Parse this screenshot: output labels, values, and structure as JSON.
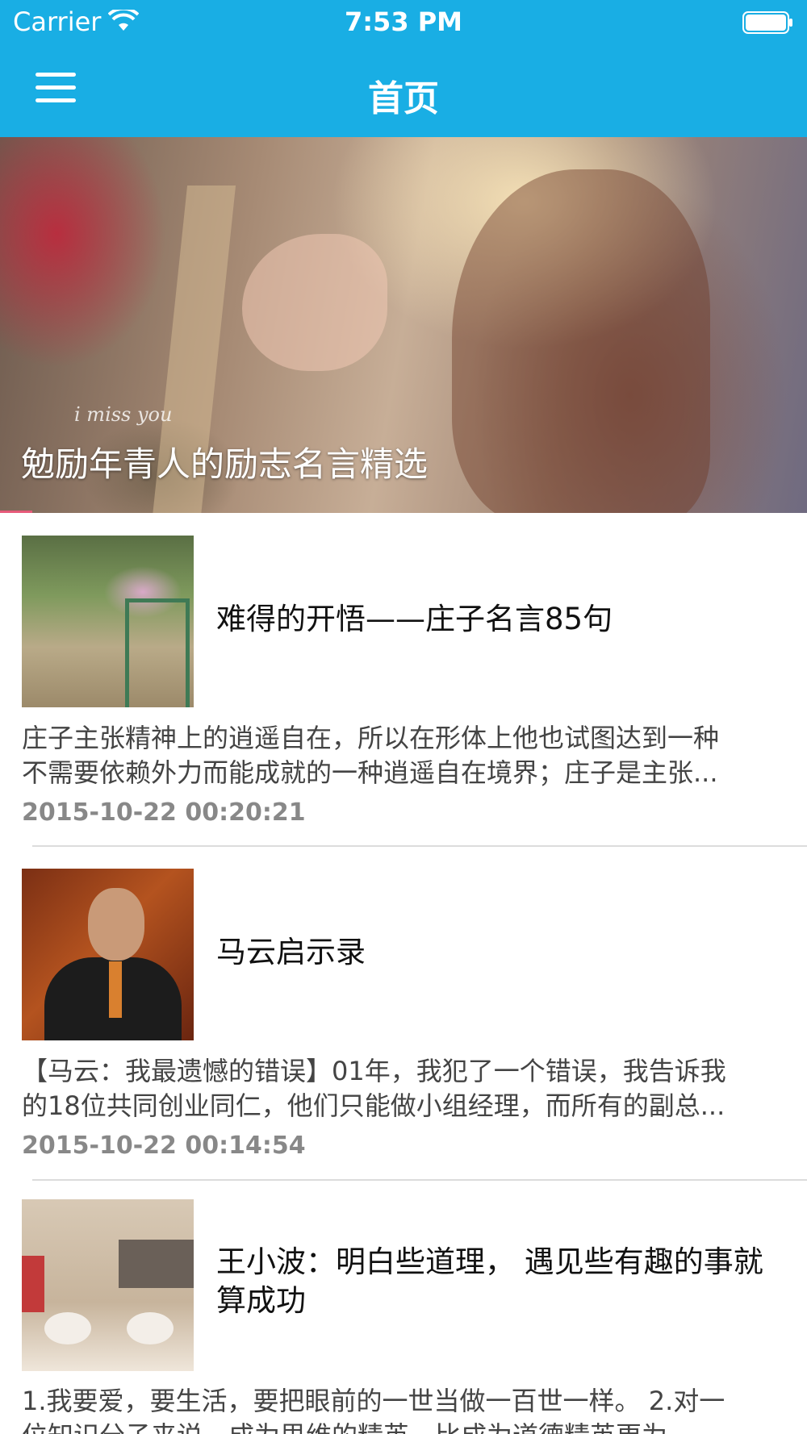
{
  "status_bar": {
    "carrier": "Carrier",
    "time": "7:53 PM",
    "wifi_icon": "wifi-icon",
    "battery_icon": "battery-icon"
  },
  "nav": {
    "title": "首页",
    "menu_icon": "hamburger-menu-icon",
    "bar_color": "#19aee4"
  },
  "hero": {
    "caption": "勉励年青人的励志名言精选",
    "image_text": "i miss you"
  },
  "articles": [
    {
      "title": "难得的开悟——庄子名言85句",
      "summary_line1": "庄子主张精神上的逍遥自在，所以在形体上他也试图达到一种",
      "summary_line2": "不需要依赖外力而能成就的一种逍遥自在境界；庄子是主张...",
      "date": "2015-10-22 00:20:21"
    },
    {
      "title": "马云启示录",
      "summary_line1": "【马云：我最遗憾的错误】01年，我犯了一个错误，我告诉我",
      "summary_line2": "的18位共同创业同仁，他们只能做小组经理，而所有的副总...",
      "date": "2015-10-22 00:14:54"
    },
    {
      "title_line1": "王小波：明白些道理， 遇见些有趣的事就",
      "title_line2": "算成功",
      "summary_line1": "1.我要爱，要生活，要把眼前的一世当做一百世一样。 2.对一",
      "summary_line2": "位知识分子来说，成为思维的精英，比成为道德精英更为"
    }
  ]
}
